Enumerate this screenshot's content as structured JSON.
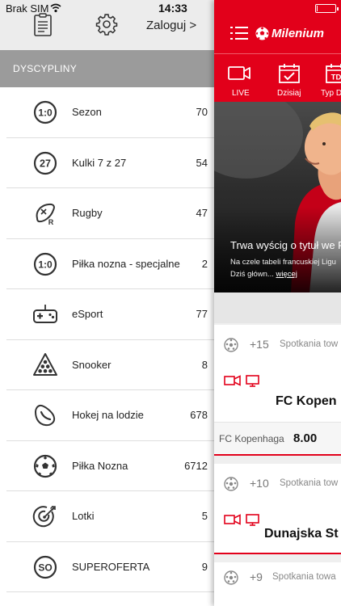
{
  "status_bar": {
    "carrier": "Brak SIM",
    "time": "14:33"
  },
  "drawer": {
    "login_label": "Zaloguj >",
    "section_title": "DYSCYPLINY",
    "sports": [
      {
        "name": "Sezon",
        "count": "70",
        "icon": "score-1-0-icon"
      },
      {
        "name": "Kulki 7 z 27",
        "count": "54",
        "icon": "number-27-icon"
      },
      {
        "name": "Rugby",
        "count": "47",
        "icon": "rugby-ball-icon"
      },
      {
        "name": "Piłka nozna - specjalne",
        "count": "2",
        "icon": "score-1-0-icon"
      },
      {
        "name": "eSport",
        "count": "77",
        "icon": "gamepad-icon"
      },
      {
        "name": "Snooker",
        "count": "8",
        "icon": "snooker-balls-icon"
      },
      {
        "name": "Hokej na lodzie",
        "count": "678",
        "icon": "hockey-puck-icon"
      },
      {
        "name": "Piłka Nozna",
        "count": "6712",
        "icon": "soccer-ball-icon"
      },
      {
        "name": "Lotki",
        "count": "5",
        "icon": "dartboard-icon"
      },
      {
        "name": "SUPEROFERTA",
        "count": "9",
        "icon": "so-badge-icon"
      }
    ],
    "icon_texts": {
      "score": "1:0",
      "kulki": "27",
      "rugby_letter": "R",
      "so": "SO"
    }
  },
  "main": {
    "brand": "Milenium",
    "nav": [
      {
        "label": "LIVE",
        "icon": "live-camera-icon"
      },
      {
        "label": "Dzisiaj",
        "icon": "calendar-check-icon"
      },
      {
        "label": "Typ D",
        "icon": "calendar-typ-icon"
      }
    ],
    "nav_icon_text": "TD",
    "hero": {
      "title": "Trwa wyścig o tytuł we Fr",
      "desc_line1": "Na czele tabeli francuskiej Ligu",
      "desc_line2": "Dziś główn...",
      "more_label": "więcej"
    },
    "cards": [
      {
        "more": "+15",
        "category": "Spotkania tow",
        "match": "FC Kopen",
        "odds_team": "FC Kopenhaga",
        "odds_value": "8.00"
      },
      {
        "more": "+10",
        "category": "Spotkania tow",
        "match": "Dunajska St"
      },
      {
        "more": "+9",
        "category": "Spotkania towa"
      }
    ]
  },
  "colors": {
    "accent": "#e2001a",
    "drawer_section": "#9b9b9b",
    "drawer_header": "#ececec"
  },
  "battery_level": 0.05
}
